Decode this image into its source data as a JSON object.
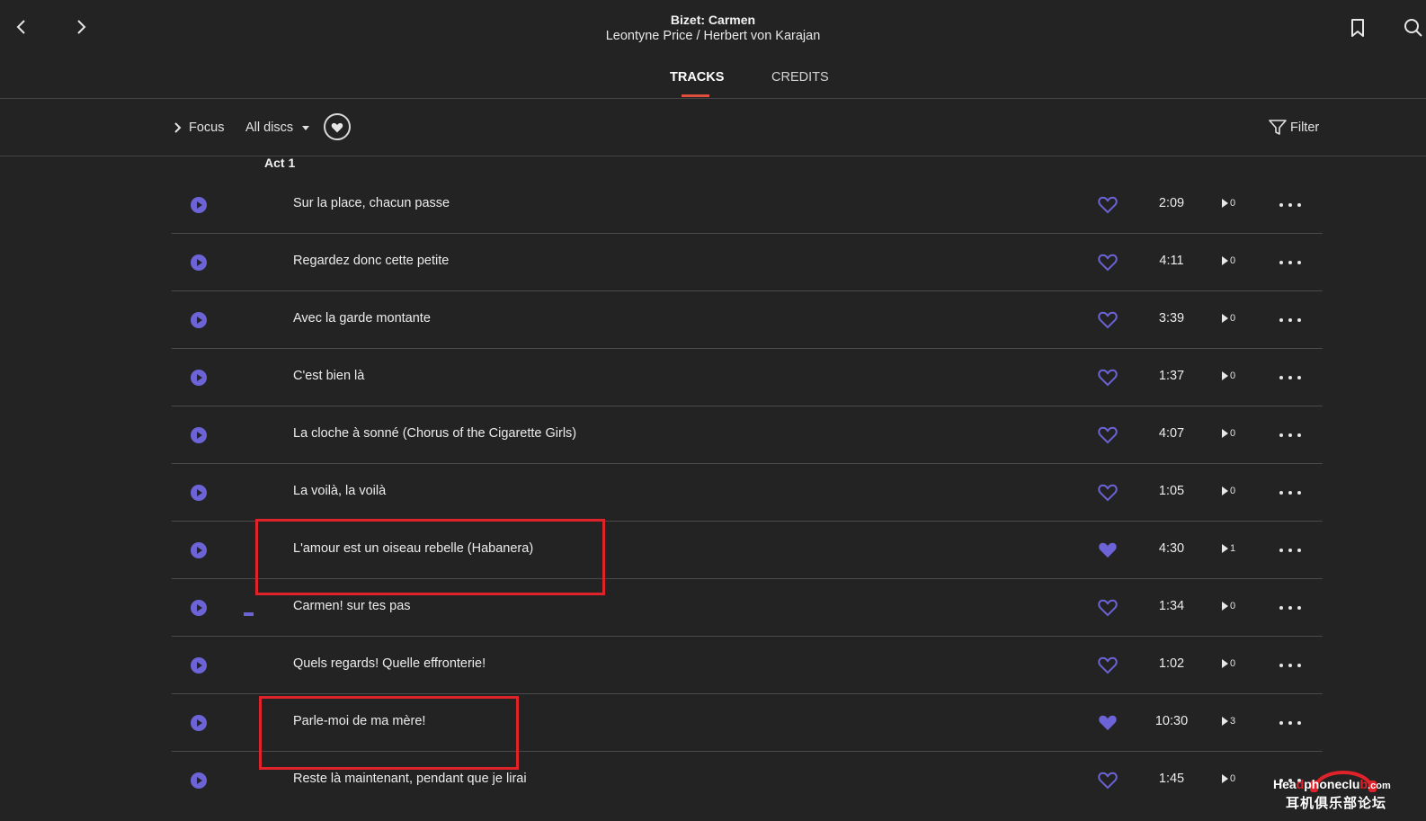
{
  "header": {
    "title": "Bizet: Carmen",
    "subtitle": "Leontyne Price / Herbert von Karajan",
    "back_icon": "chevron-left-icon",
    "forward_icon": "chevron-right-icon",
    "bookmark_icon": "bookmark-icon",
    "search_icon": "search-icon"
  },
  "tabs": [
    {
      "label": "TRACKS",
      "active": true
    },
    {
      "label": "CREDITS",
      "active": false
    }
  ],
  "toolbar": {
    "focus_label": "Focus",
    "discs_label": "All discs",
    "filter_label": "Filter"
  },
  "section": {
    "title": "Act 1"
  },
  "colors": {
    "background": "#232323",
    "accent": "#6b63d6",
    "tab_underline": "#e0503e",
    "highlight_box": "#e0222a"
  },
  "tracks": [
    {
      "name": "Sur la place, chacun passe",
      "duration": "2:09",
      "plays": "0",
      "favorite": false
    },
    {
      "name": "Regardez donc cette petite",
      "duration": "4:11",
      "plays": "0",
      "favorite": false
    },
    {
      "name": "Avec la garde montante",
      "duration": "3:39",
      "plays": "0",
      "favorite": false
    },
    {
      "name": "C'est bien là",
      "duration": "1:37",
      "plays": "0",
      "favorite": false
    },
    {
      "name": "La cloche à sonné (Chorus of the Cigarette Girls)",
      "duration": "4:07",
      "plays": "0",
      "favorite": false
    },
    {
      "name": "La voilà, la voilà",
      "duration": "1:05",
      "plays": "0",
      "favorite": false
    },
    {
      "name": "L'amour est un oiseau rebelle (Habanera)",
      "duration": "4:30",
      "plays": "1",
      "favorite": true
    },
    {
      "name": "Carmen! sur tes pas",
      "duration": "1:34",
      "plays": "0",
      "favorite": false,
      "now_playing": true
    },
    {
      "name": "Quels regards! Quelle effronterie!",
      "duration": "1:02",
      "plays": "0",
      "favorite": false
    },
    {
      "name": "Parle-moi de ma mère!",
      "duration": "10:30",
      "plays": "3",
      "favorite": true
    },
    {
      "name": "Reste là maintenant, pendant que je lirai",
      "duration": "1:45",
      "plays": "0",
      "favorite": false
    }
  ],
  "watermark": {
    "line1_a": "Hea",
    "line1_b": "phoneclu",
    "line1_c": ".com",
    "line2": "耳机俱乐部论坛"
  }
}
